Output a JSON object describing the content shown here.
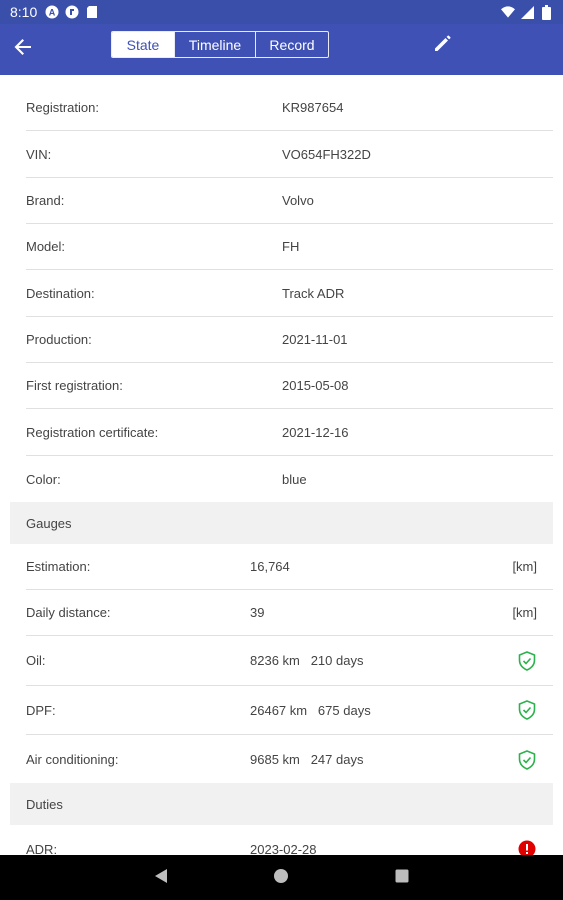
{
  "status_bar": {
    "time": "8:10",
    "left_icons": [
      "navigation-a-icon",
      "app-icon",
      "sd-card-icon"
    ],
    "right_icons": [
      "wifi-icon",
      "cellular-icon",
      "battery-icon"
    ]
  },
  "app_bar": {
    "background": "#3f51b5",
    "back_icon": "arrow-left-icon",
    "tabs": [
      {
        "label": "State",
        "active": true
      },
      {
        "label": "Timeline",
        "active": false
      },
      {
        "label": "Record",
        "active": false
      }
    ],
    "edit_icon": "pencil-icon"
  },
  "details": [
    {
      "label": "Registration:",
      "value": "KR987654"
    },
    {
      "label": "VIN:",
      "value": "VO654FH322D"
    },
    {
      "label": "Brand:",
      "value": "Volvo"
    },
    {
      "label": "Model:",
      "value": "FH"
    },
    {
      "label": "Destination:",
      "value": "Track ADR"
    },
    {
      "label": "Production:",
      "value": "2021-11-01"
    },
    {
      "label": "First registration:",
      "value": "2015-05-08"
    },
    {
      "label": "Registration certificate:",
      "value": "2021-12-16"
    },
    {
      "label": "Color:",
      "value": "blue"
    }
  ],
  "gauges": {
    "title": "Gauges",
    "items": [
      {
        "label": "Estimation:",
        "value": "16,764",
        "unit": "[km]"
      },
      {
        "label": "Daily distance:",
        "value": "39",
        "unit": "[km]"
      },
      {
        "label": "Oil:",
        "value": "8236 km   210 days",
        "status_icon": "shield-check-icon",
        "status_color": "#2bb24c"
      },
      {
        "label": "DPF:",
        "value": "26467 km   675 days",
        "status_icon": "shield-check-icon",
        "status_color": "#2bb24c"
      },
      {
        "label": "Air conditioning:",
        "value": "9685 km   247 days",
        "status_icon": "shield-check-icon",
        "status_color": "#2bb24c"
      }
    ]
  },
  "duties": {
    "title": "Duties",
    "items": [
      {
        "label": "ADR:",
        "value": "2023-02-28",
        "status_icon": "alert-icon",
        "status_color": "#e00000"
      }
    ]
  },
  "nav_bar": {
    "icons": [
      "back-triangle-icon",
      "home-circle-icon",
      "recents-square-icon"
    ]
  }
}
